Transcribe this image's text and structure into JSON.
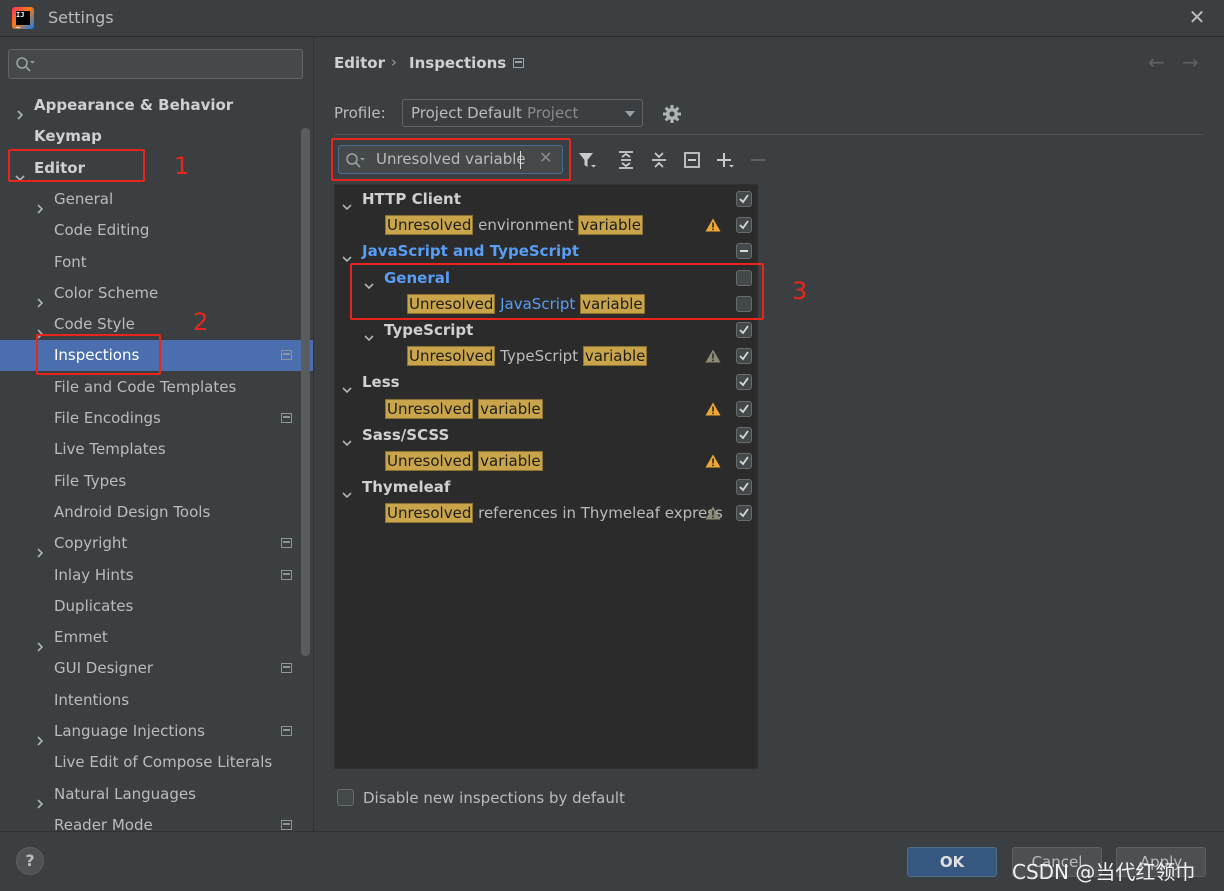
{
  "window": {
    "title": "Settings"
  },
  "sidebar": {
    "items": [
      {
        "label": "Appearance & Behavior",
        "bold": true,
        "chevron": "right",
        "indent": 0
      },
      {
        "label": "Keymap",
        "bold": true,
        "chevron": "none",
        "indent": 0
      },
      {
        "label": "Editor",
        "bold": true,
        "chevron": "down",
        "indent": 0
      },
      {
        "label": "General",
        "chevron": "right",
        "indent": 1
      },
      {
        "label": "Code Editing",
        "chevron": "none",
        "indent": 1
      },
      {
        "label": "Font",
        "chevron": "none",
        "indent": 1
      },
      {
        "label": "Color Scheme",
        "chevron": "right",
        "indent": 1
      },
      {
        "label": "Code Style",
        "chevron": "right",
        "indent": 1
      },
      {
        "label": "Inspections",
        "chevron": "none",
        "indent": 1,
        "selected": true,
        "project_icon": true
      },
      {
        "label": "File and Code Templates",
        "chevron": "none",
        "indent": 1
      },
      {
        "label": "File Encodings",
        "chevron": "none",
        "indent": 1,
        "project_icon": true
      },
      {
        "label": "Live Templates",
        "chevron": "none",
        "indent": 1
      },
      {
        "label": "File Types",
        "chevron": "none",
        "indent": 1
      },
      {
        "label": "Android Design Tools",
        "chevron": "none",
        "indent": 1
      },
      {
        "label": "Copyright",
        "chevron": "right",
        "indent": 1,
        "project_icon": true
      },
      {
        "label": "Inlay Hints",
        "chevron": "none",
        "indent": 1,
        "project_icon": true
      },
      {
        "label": "Duplicates",
        "chevron": "none",
        "indent": 1
      },
      {
        "label": "Emmet",
        "chevron": "right",
        "indent": 1
      },
      {
        "label": "GUI Designer",
        "chevron": "none",
        "indent": 1,
        "project_icon": true
      },
      {
        "label": "Intentions",
        "chevron": "none",
        "indent": 1
      },
      {
        "label": "Language Injections",
        "chevron": "right",
        "indent": 1,
        "project_icon": true
      },
      {
        "label": "Live Edit of Compose Literals",
        "chevron": "none",
        "indent": 1
      },
      {
        "label": "Natural Languages",
        "chevron": "right",
        "indent": 1
      },
      {
        "label": "Reader Mode",
        "chevron": "none",
        "indent": 1,
        "project_icon": true
      }
    ]
  },
  "breadcrumb": {
    "parent": "Editor",
    "separator": "›",
    "current": "Inspections"
  },
  "profile": {
    "label": "Profile:",
    "value": "Project Default",
    "scope": "Project"
  },
  "filter": {
    "value": "Unresolved variable"
  },
  "tree": {
    "rows": [
      {
        "level": 0,
        "chevron": "down",
        "bold": true,
        "parts": [
          {
            "t": "HTTP Client"
          }
        ],
        "checkbox": "checked"
      },
      {
        "level": 1,
        "chevron": "none",
        "parts": [
          {
            "t": "Unresolved",
            "hl": true
          },
          {
            "t": " environment "
          },
          {
            "t": "variable",
            "hl": true
          }
        ],
        "warning": "bright",
        "checkbox": "checked"
      },
      {
        "level": 0,
        "chevron": "down",
        "bold": true,
        "blue": true,
        "parts": [
          {
            "t": "JavaScript and TypeScript"
          }
        ],
        "checkbox": "partial"
      },
      {
        "level": 1,
        "chevron": "down",
        "bold": true,
        "blue": true,
        "parts": [
          {
            "t": "General"
          }
        ],
        "checkbox": "unchecked"
      },
      {
        "level": 2,
        "chevron": "none",
        "parts": [
          {
            "t": "Unresolved",
            "hl": true
          },
          {
            "t": " "
          },
          {
            "t": "JavaScript",
            "blue": true
          },
          {
            "t": " "
          },
          {
            "t": "variable",
            "hl": true
          }
        ],
        "checkbox": "unchecked"
      },
      {
        "level": 1,
        "chevron": "down",
        "bold": true,
        "parts": [
          {
            "t": "TypeScript"
          }
        ],
        "checkbox": "checked"
      },
      {
        "level": 2,
        "chevron": "none",
        "parts": [
          {
            "t": "Unresolved",
            "hl": true
          },
          {
            "t": " TypeScript "
          },
          {
            "t": "variable",
            "hl": true
          }
        ],
        "warning": "dim",
        "checkbox": "checked"
      },
      {
        "level": 0,
        "chevron": "down",
        "bold": true,
        "parts": [
          {
            "t": "Less"
          }
        ],
        "checkbox": "checked"
      },
      {
        "level": 1,
        "chevron": "none",
        "parts": [
          {
            "t": "Unresolved",
            "hl": true
          },
          {
            "t": " "
          },
          {
            "t": "variable",
            "hl": true
          }
        ],
        "warning": "bright",
        "checkbox": "checked"
      },
      {
        "level": 0,
        "chevron": "down",
        "bold": true,
        "parts": [
          {
            "t": "Sass/SCSS"
          }
        ],
        "checkbox": "checked"
      },
      {
        "level": 1,
        "chevron": "none",
        "parts": [
          {
            "t": "Unresolved",
            "hl": true
          },
          {
            "t": " "
          },
          {
            "t": "variable",
            "hl": true
          }
        ],
        "warning": "bright",
        "checkbox": "checked"
      },
      {
        "level": 0,
        "chevron": "down",
        "bold": true,
        "parts": [
          {
            "t": "Thymeleaf"
          }
        ],
        "checkbox": "checked"
      },
      {
        "level": 1,
        "chevron": "none",
        "parts": [
          {
            "t": "Unresolved",
            "hl": true
          },
          {
            "t": " references in Thymeleaf express"
          }
        ],
        "warning": "dim",
        "checkbox": "checked"
      }
    ]
  },
  "options": {
    "disable_new_label": "Disable new inspections by default",
    "disable_new_checked": false
  },
  "buttons": {
    "help": "?",
    "ok": "OK",
    "cancel": "Cancel",
    "apply": "Apply"
  },
  "annotations": {
    "n1": "1",
    "n2": "2",
    "n3": "3"
  },
  "watermark": "CSDN @当代红领巾",
  "colors": {
    "accent": "#4b6eaf",
    "highlight": "#c9a44a",
    "annotation": "#e8251c",
    "link": "#589df6"
  }
}
